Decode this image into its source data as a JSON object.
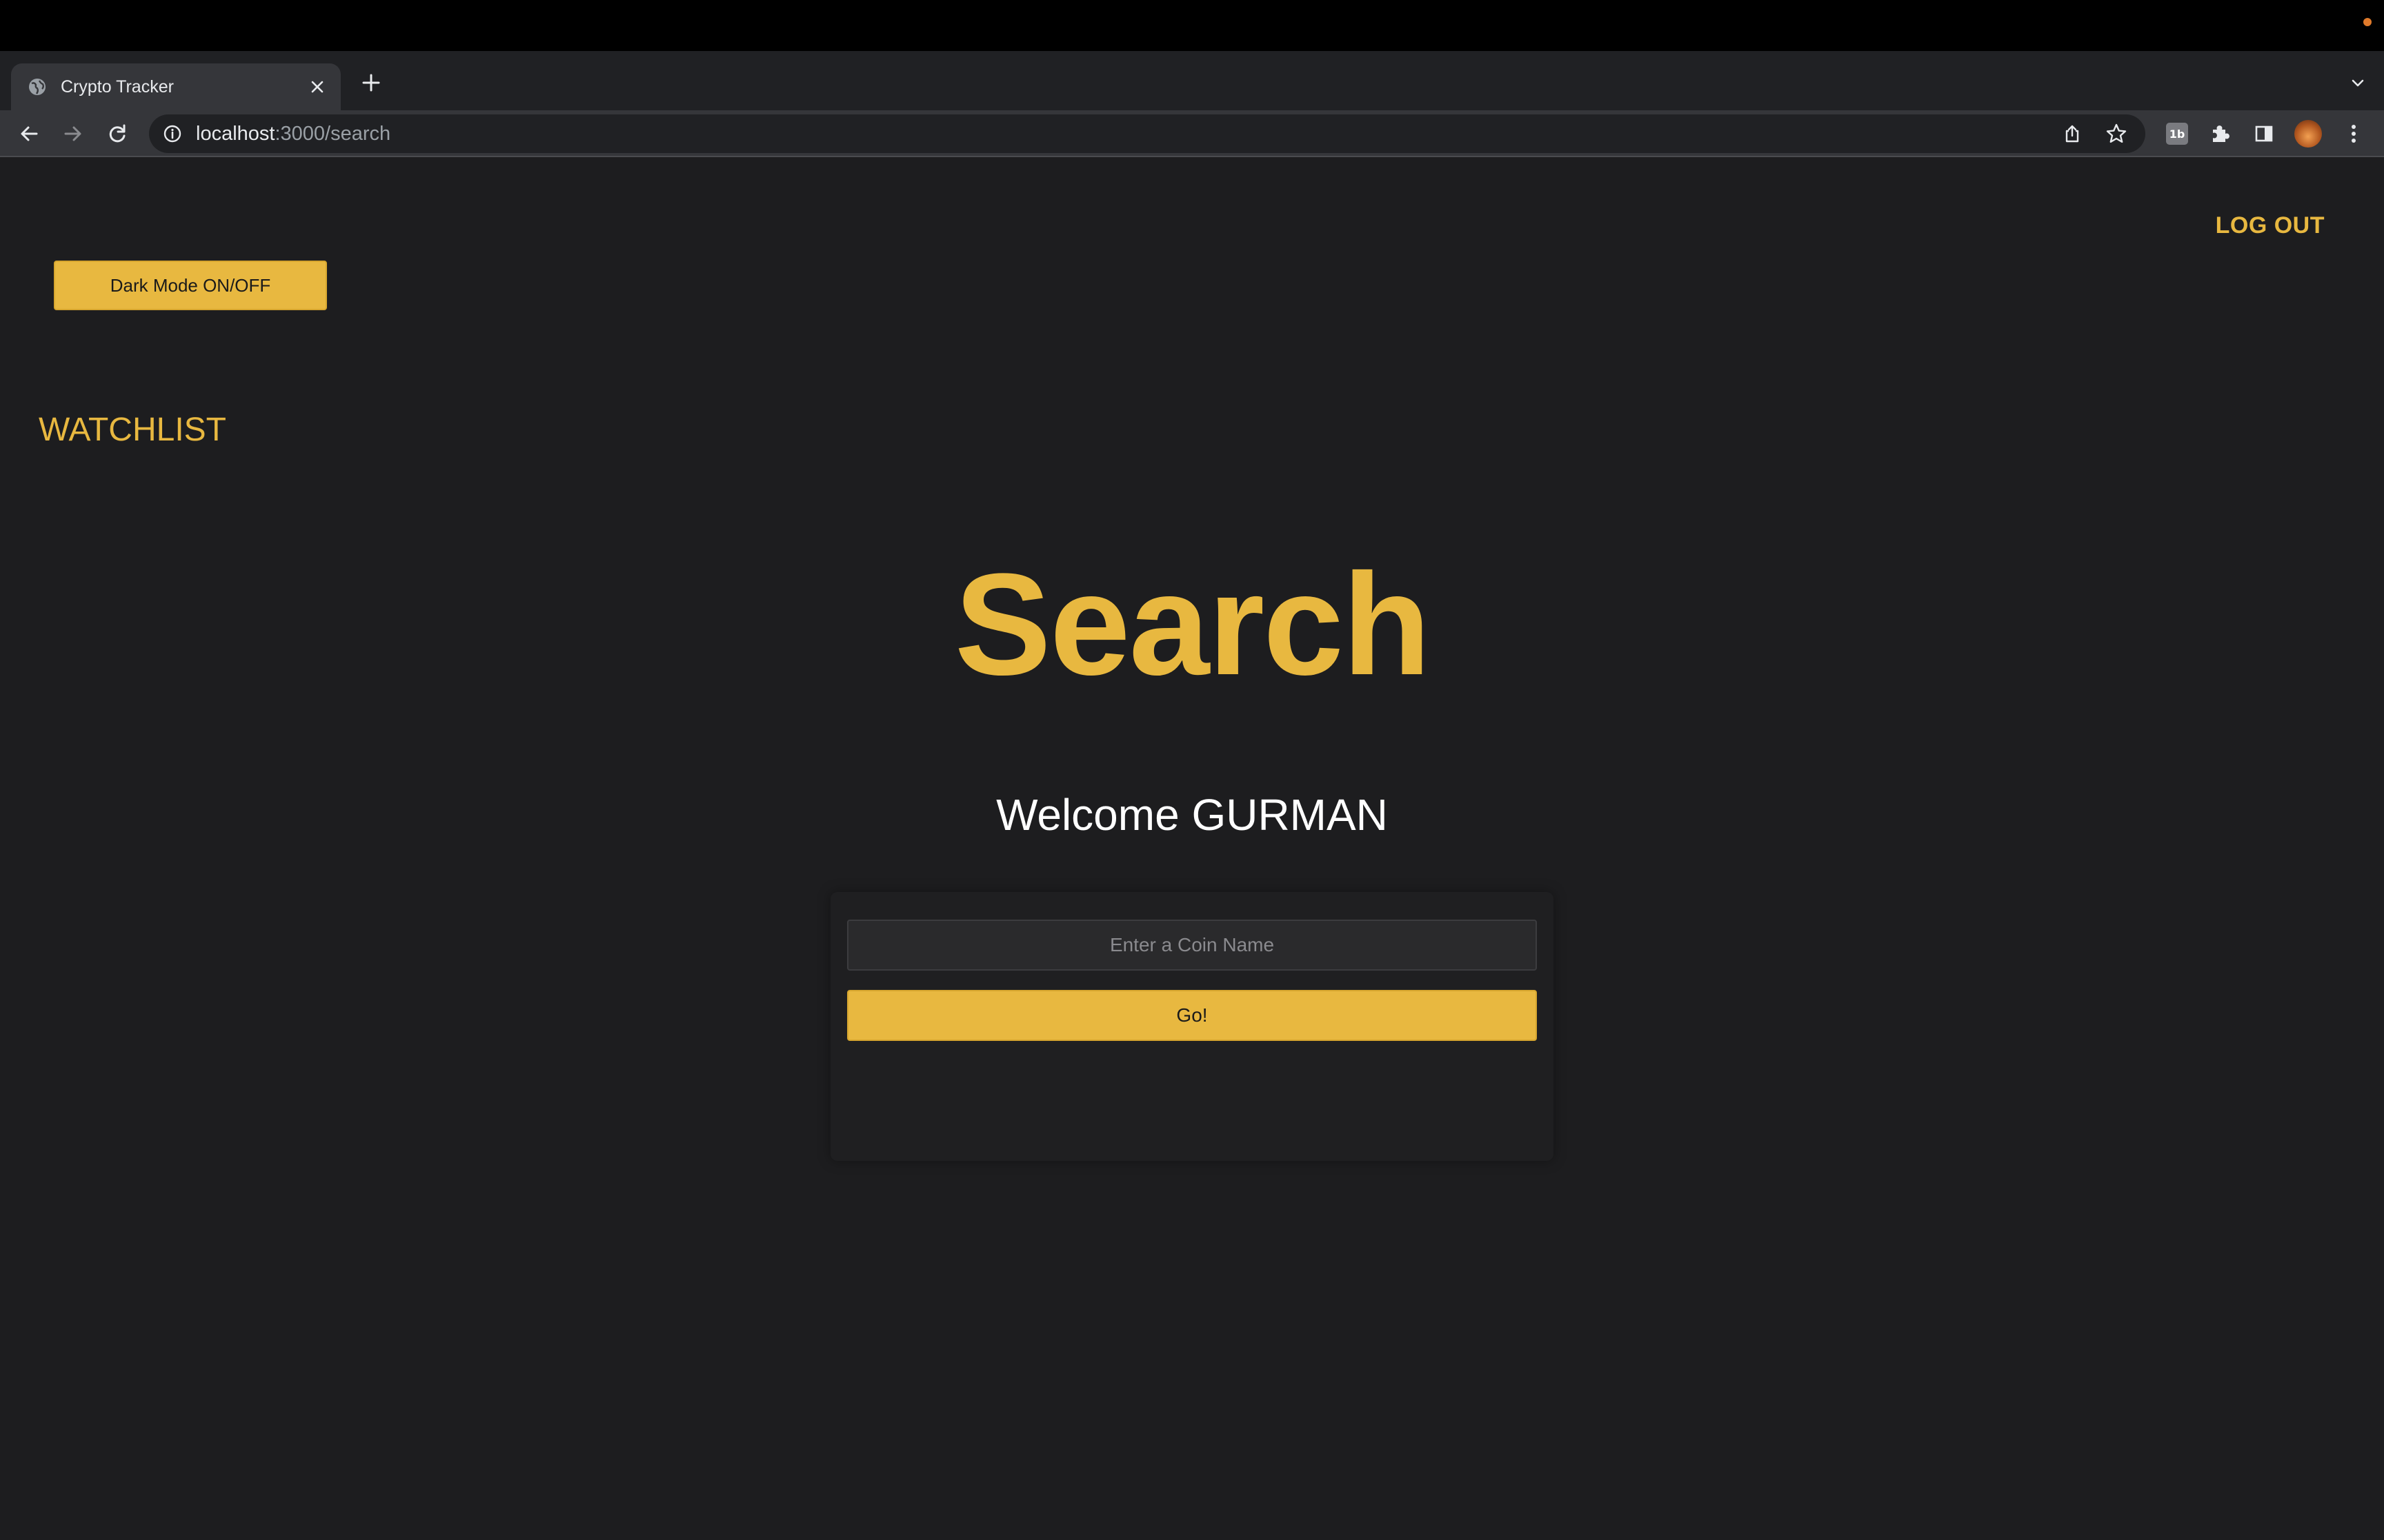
{
  "browser": {
    "tab": {
      "title": "Crypto Tracker",
      "favicon": "globe-icon"
    },
    "address": {
      "host": "localhost",
      "path": ":3000/search"
    },
    "icons": [
      "back-arrow-icon",
      "forward-arrow-icon",
      "reload-icon",
      "info-icon",
      "share-icon",
      "bookmark-star-icon",
      "extension-1b-icon",
      "puzzle-icon",
      "sidebar-icon",
      "profile-avatar",
      "kebab-menu-icon"
    ],
    "extension_badge": "1b"
  },
  "header": {
    "logout_label": "LOG OUT"
  },
  "controls": {
    "dark_mode_label": "Dark Mode ON/OFF"
  },
  "nav": {
    "watchlist_label": "WATCHLIST"
  },
  "main": {
    "title": "Search",
    "welcome": "Welcome GURMAN",
    "search": {
      "placeholder": "Enter a Coin Name",
      "value": "",
      "button_label": "Go!"
    }
  },
  "colors": {
    "accent": "#e8b840",
    "background": "#1d1d1f",
    "text": "#ffffff"
  }
}
